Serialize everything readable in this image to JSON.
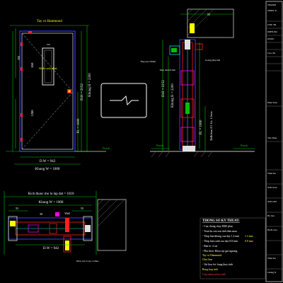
{
  "front_view": {
    "handle_label": "Tay co Hammond",
    "glass_label": "Kinh cach nhiet",
    "hinge_label": "Ban le",
    "width_inner_label": "D.W = 942",
    "width_frame_label": "Khung W = 1000",
    "height_inner_label": "D.H = 2152",
    "height_frame_label": "Khung H = 2200",
    "height_lower_label": "FL = 1000",
    "dim_850": "850",
    "dim_1200": "1200",
    "dim_300": "300",
    "floor_label": "Finish",
    "glass_w_label": "150"
  },
  "section_view": {
    "label_a": "Thep day 0.8mm",
    "label_b": "Goang ghep tinh",
    "label_c": "Thep dau 0.8 mm",
    "label_d": "Khung H = 2200",
    "label_e": "D.H = 2152",
    "label_f": "FL = 1000",
    "label_g": "Rolh bam 2/1 1/x: 1.5mm",
    "floor_label": "Finish",
    "dim_top": "55"
  },
  "plan_view": {
    "title": "Kich thuoc mo lo lap dat = 1010",
    "frame_w": "Khung W = 1000",
    "inner_w": "D.W = 942",
    "dim_55_left": "55",
    "dim_55_right": "55",
    "dim_30": "30",
    "wall_label": "Wall",
    "note_label": "Khoa cua va tay co khoa"
  },
  "spec_box": {
    "title": "THONG SO KY THUAT:",
    "lines": [
      "- Cua chong chay EI60 phut",
      "- Toan bo cua son tinh dien mau",
      "- Thep lam khung cua day 1.2 mm",
      "- Thep lam canh cua day 0.8 mm",
      "- Ban le: 4 cai",
      "- Phu kien: Khoa tay gat nguong",
      "  Tay co Hammond",
      "  Chot lien",
      "- Vat lieu lot: bong thuy tinh",
      "  Bong hop tinh",
      "  Giay nhan ta hoa tinh"
    ],
    "highlight_1": "1.2 mm",
    "highlight_2": "0.8 mm"
  },
  "title_block": {
    "rows": [
      "THANH",
      "THIET K",
      "CHU TR",
      "DIEN NO",
      "DUOC",
      "Cua cha",
      "Phan Tran",
      "Thu Thiet",
      "Thiet Ke",
      "XIN XAC",
      "XIN CHI",
      "Ho ban",
      "BAN Chu",
      "Thiet Ke"
    ],
    "mid_rows": [
      "Thiet Ke",
      "NGAY",
      "XIN XAC",
      "Hop chi",
      "Sp Ten",
      "M",
      "So Dien",
      "Chung N"
    ]
  },
  "colors": {
    "background": "#000000",
    "dim": "#00c000",
    "frame": "#3030ff",
    "leaf": "#e0e0e0",
    "red": "#ff2020",
    "yellow": "#ffff00",
    "cyan": "#00e0e0",
    "magenta": "#ff00ff"
  }
}
